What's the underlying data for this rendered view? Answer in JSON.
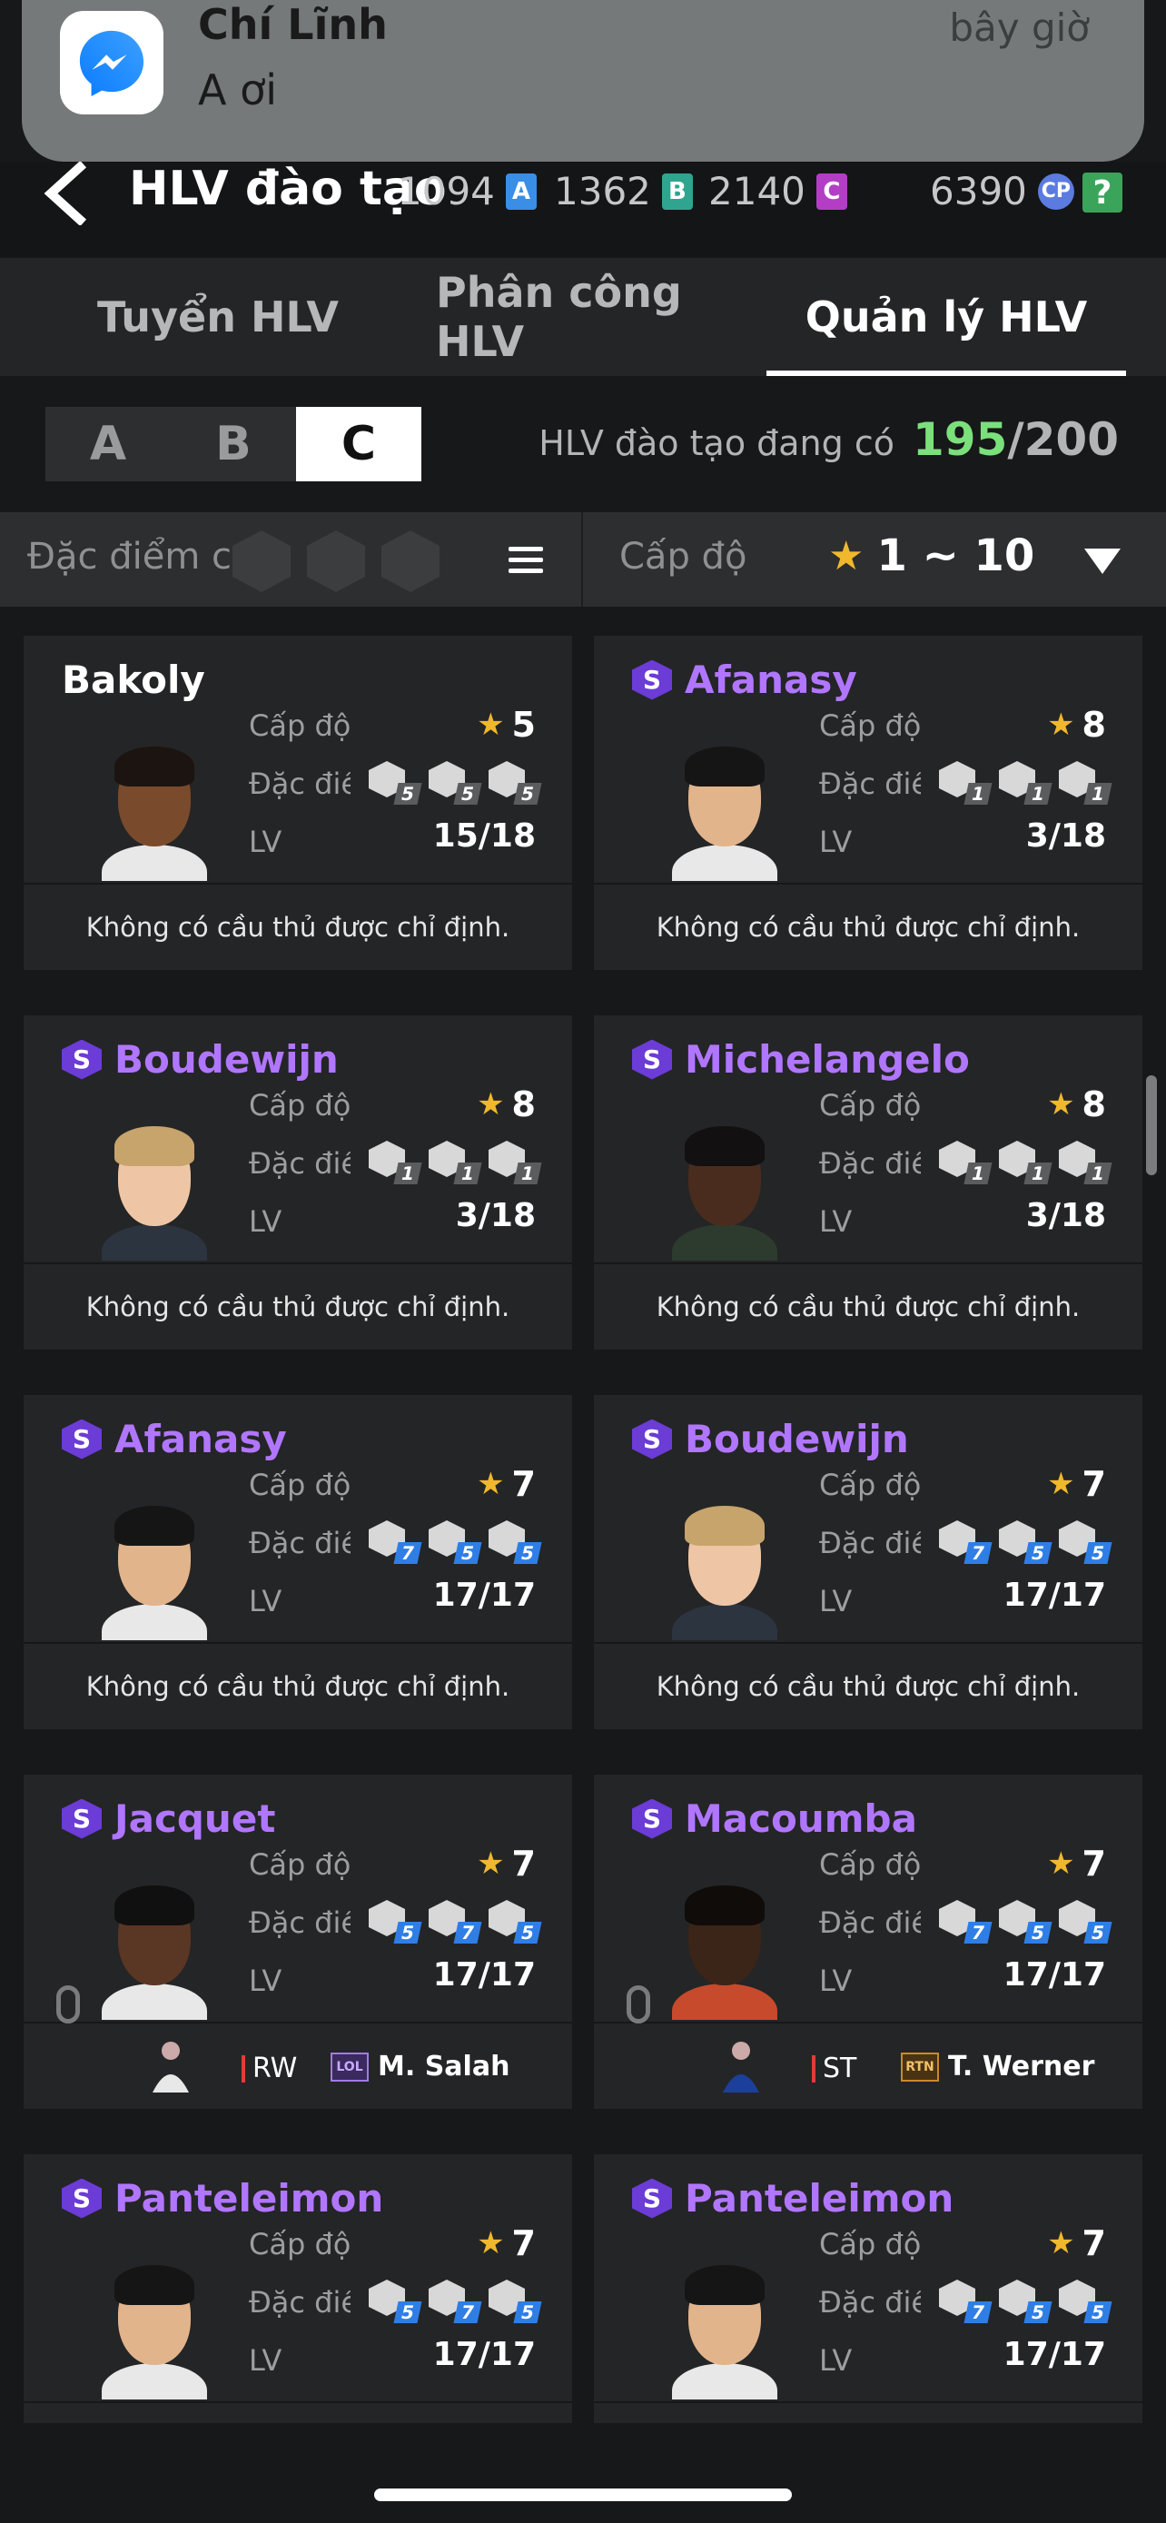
{
  "notification": {
    "title": "Chí Lĩnh",
    "message": "A ơi",
    "time": "bây giờ",
    "icon": "messenger-icon"
  },
  "header": {
    "title": "HLV đào tạo",
    "currencies": [
      {
        "value": "1094",
        "badge": "A",
        "color": "#3a8ee6"
      },
      {
        "value": "1362",
        "badge": "B",
        "color": "#2fa58f"
      },
      {
        "value": "2140",
        "badge": "C",
        "color": "#b33ec5"
      }
    ],
    "cp": {
      "value": "6390",
      "badge": "CP"
    },
    "help": "?"
  },
  "tabs": [
    {
      "label": "Tuyển HLV",
      "active": false
    },
    {
      "label": "Phân công HLV",
      "active": false
    },
    {
      "label": "Quản lý HLV",
      "active": true
    }
  ],
  "grade_tabs": [
    "A",
    "B",
    "C"
  ],
  "active_grade": "C",
  "count": {
    "label": "HLV đào tạo đang có",
    "current": "195",
    "max": "/200"
  },
  "filter": {
    "trait_label": "Đặc điểm c",
    "level_label": "Cấp độ",
    "level_range": "1 ~ 10"
  },
  "labels": {
    "level": "Cấp độ",
    "trait": "Đặc điểm",
    "lv": "LV",
    "no_player": "Không có cầu thủ được chỉ định."
  },
  "coaches": [
    {
      "name": "Bakoly",
      "special": false,
      "level": "5",
      "lv": "15/18",
      "traits": [
        "5",
        "5",
        "5"
      ],
      "trait_color": "grey",
      "skin": "#7a4a2c",
      "hair": "#1c1410",
      "body": "#e8e8e8",
      "assigned": null
    },
    {
      "name": "Afanasy",
      "special": true,
      "level": "8",
      "lv": "3/18",
      "traits": [
        "1",
        "1",
        "1"
      ],
      "trait_color": "grey",
      "skin": "#e2b48c",
      "hair": "#151515",
      "body": "#e8e8e8",
      "assigned": null
    },
    {
      "name": "Boudewijn",
      "special": true,
      "level": "8",
      "lv": "3/18",
      "traits": [
        "1",
        "1",
        "1"
      ],
      "trait_color": "grey",
      "skin": "#eec6a6",
      "hair": "#c7a46c",
      "body": "#2c3440",
      "assigned": null
    },
    {
      "name": "Michelangelo",
      "special": true,
      "level": "8",
      "lv": "3/18",
      "traits": [
        "1",
        "1",
        "1"
      ],
      "trait_color": "grey",
      "skin": "#4a2c1e",
      "hair": "#121010",
      "body": "#2d3b2f",
      "assigned": null
    },
    {
      "name": "Afanasy",
      "special": true,
      "level": "7",
      "lv": "17/17",
      "traits": [
        "7",
        "5",
        "5"
      ],
      "trait_color": "blue",
      "skin": "#e2b48c",
      "hair": "#151515",
      "body": "#e8e8e8",
      "assigned": null
    },
    {
      "name": "Boudewijn",
      "special": true,
      "level": "7",
      "lv": "17/17",
      "traits": [
        "7",
        "5",
        "5"
      ],
      "trait_color": "blue",
      "skin": "#eec6a6",
      "hair": "#c7a46c",
      "body": "#2c3440",
      "assigned": null
    },
    {
      "name": "Jacquet",
      "special": true,
      "level": "7",
      "lv": "17/17",
      "traits": [
        "5",
        "7",
        "5"
      ],
      "trait_color": "blue",
      "skin": "#5a3624",
      "hair": "#101010",
      "body": "#e8e8e8",
      "assigned": {
        "position": "RW",
        "season": "LOL",
        "player": "M. Salah",
        "season_style": "lol"
      }
    },
    {
      "name": "Macoumba",
      "special": true,
      "level": "7",
      "lv": "17/17",
      "traits": [
        "7",
        "5",
        "5"
      ],
      "trait_color": "blue",
      "skin": "#3b2418",
      "hair": "#0f0c0a",
      "body": "#c74a2c",
      "assigned": {
        "position": "ST",
        "season": "RTN",
        "player": "T. Werner",
        "season_style": "rtn"
      }
    },
    {
      "name": "Panteleimon",
      "special": true,
      "level": "7",
      "lv": "17/17",
      "traits": [
        "5",
        "7",
        "5"
      ],
      "trait_color": "blue",
      "skin": "#e2b48c",
      "hair": "#151515",
      "body": "#e8e8e8",
      "assigned": null
    },
    {
      "name": "Panteleimon",
      "special": true,
      "level": "7",
      "lv": "17/17",
      "traits": [
        "7",
        "5",
        "5"
      ],
      "trait_color": "blue",
      "skin": "#e2b48c",
      "hair": "#151515",
      "body": "#e8e8e8",
      "assigned": null
    }
  ]
}
